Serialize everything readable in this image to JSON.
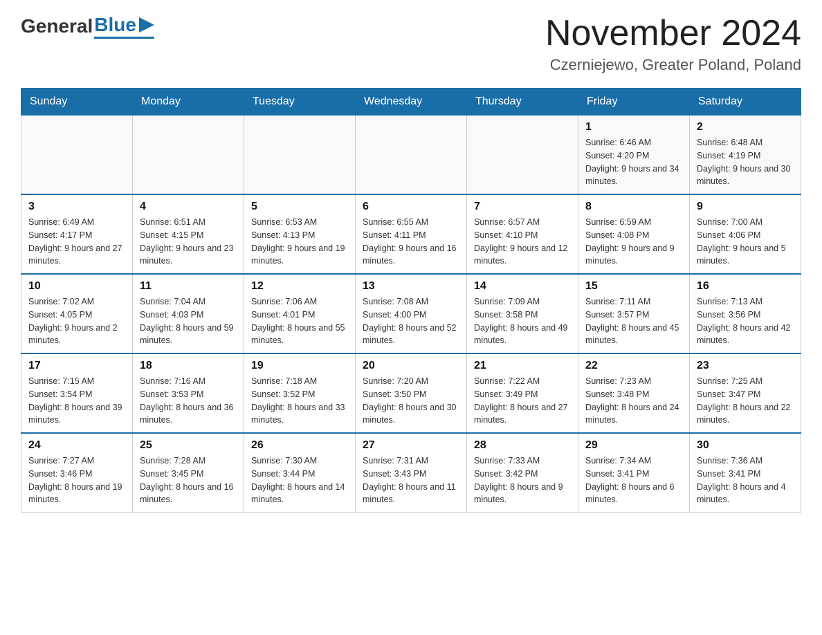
{
  "logo": {
    "general": "General",
    "blue": "Blue"
  },
  "title": "November 2024",
  "location": "Czerniejewo, Greater Poland, Poland",
  "weekdays": [
    "Sunday",
    "Monday",
    "Tuesday",
    "Wednesday",
    "Thursday",
    "Friday",
    "Saturday"
  ],
  "rows": [
    [
      {
        "day": "",
        "info": ""
      },
      {
        "day": "",
        "info": ""
      },
      {
        "day": "",
        "info": ""
      },
      {
        "day": "",
        "info": ""
      },
      {
        "day": "",
        "info": ""
      },
      {
        "day": "1",
        "info": "Sunrise: 6:46 AM\nSunset: 4:20 PM\nDaylight: 9 hours and 34 minutes."
      },
      {
        "day": "2",
        "info": "Sunrise: 6:48 AM\nSunset: 4:19 PM\nDaylight: 9 hours and 30 minutes."
      }
    ],
    [
      {
        "day": "3",
        "info": "Sunrise: 6:49 AM\nSunset: 4:17 PM\nDaylight: 9 hours and 27 minutes."
      },
      {
        "day": "4",
        "info": "Sunrise: 6:51 AM\nSunset: 4:15 PM\nDaylight: 9 hours and 23 minutes."
      },
      {
        "day": "5",
        "info": "Sunrise: 6:53 AM\nSunset: 4:13 PM\nDaylight: 9 hours and 19 minutes."
      },
      {
        "day": "6",
        "info": "Sunrise: 6:55 AM\nSunset: 4:11 PM\nDaylight: 9 hours and 16 minutes."
      },
      {
        "day": "7",
        "info": "Sunrise: 6:57 AM\nSunset: 4:10 PM\nDaylight: 9 hours and 12 minutes."
      },
      {
        "day": "8",
        "info": "Sunrise: 6:59 AM\nSunset: 4:08 PM\nDaylight: 9 hours and 9 minutes."
      },
      {
        "day": "9",
        "info": "Sunrise: 7:00 AM\nSunset: 4:06 PM\nDaylight: 9 hours and 5 minutes."
      }
    ],
    [
      {
        "day": "10",
        "info": "Sunrise: 7:02 AM\nSunset: 4:05 PM\nDaylight: 9 hours and 2 minutes."
      },
      {
        "day": "11",
        "info": "Sunrise: 7:04 AM\nSunset: 4:03 PM\nDaylight: 8 hours and 59 minutes."
      },
      {
        "day": "12",
        "info": "Sunrise: 7:06 AM\nSunset: 4:01 PM\nDaylight: 8 hours and 55 minutes."
      },
      {
        "day": "13",
        "info": "Sunrise: 7:08 AM\nSunset: 4:00 PM\nDaylight: 8 hours and 52 minutes."
      },
      {
        "day": "14",
        "info": "Sunrise: 7:09 AM\nSunset: 3:58 PM\nDaylight: 8 hours and 49 minutes."
      },
      {
        "day": "15",
        "info": "Sunrise: 7:11 AM\nSunset: 3:57 PM\nDaylight: 8 hours and 45 minutes."
      },
      {
        "day": "16",
        "info": "Sunrise: 7:13 AM\nSunset: 3:56 PM\nDaylight: 8 hours and 42 minutes."
      }
    ],
    [
      {
        "day": "17",
        "info": "Sunrise: 7:15 AM\nSunset: 3:54 PM\nDaylight: 8 hours and 39 minutes."
      },
      {
        "day": "18",
        "info": "Sunrise: 7:16 AM\nSunset: 3:53 PM\nDaylight: 8 hours and 36 minutes."
      },
      {
        "day": "19",
        "info": "Sunrise: 7:18 AM\nSunset: 3:52 PM\nDaylight: 8 hours and 33 minutes."
      },
      {
        "day": "20",
        "info": "Sunrise: 7:20 AM\nSunset: 3:50 PM\nDaylight: 8 hours and 30 minutes."
      },
      {
        "day": "21",
        "info": "Sunrise: 7:22 AM\nSunset: 3:49 PM\nDaylight: 8 hours and 27 minutes."
      },
      {
        "day": "22",
        "info": "Sunrise: 7:23 AM\nSunset: 3:48 PM\nDaylight: 8 hours and 24 minutes."
      },
      {
        "day": "23",
        "info": "Sunrise: 7:25 AM\nSunset: 3:47 PM\nDaylight: 8 hours and 22 minutes."
      }
    ],
    [
      {
        "day": "24",
        "info": "Sunrise: 7:27 AM\nSunset: 3:46 PM\nDaylight: 8 hours and 19 minutes."
      },
      {
        "day": "25",
        "info": "Sunrise: 7:28 AM\nSunset: 3:45 PM\nDaylight: 8 hours and 16 minutes."
      },
      {
        "day": "26",
        "info": "Sunrise: 7:30 AM\nSunset: 3:44 PM\nDaylight: 8 hours and 14 minutes."
      },
      {
        "day": "27",
        "info": "Sunrise: 7:31 AM\nSunset: 3:43 PM\nDaylight: 8 hours and 11 minutes."
      },
      {
        "day": "28",
        "info": "Sunrise: 7:33 AM\nSunset: 3:42 PM\nDaylight: 8 hours and 9 minutes."
      },
      {
        "day": "29",
        "info": "Sunrise: 7:34 AM\nSunset: 3:41 PM\nDaylight: 8 hours and 6 minutes."
      },
      {
        "day": "30",
        "info": "Sunrise: 7:36 AM\nSunset: 3:41 PM\nDaylight: 8 hours and 4 minutes."
      }
    ]
  ]
}
